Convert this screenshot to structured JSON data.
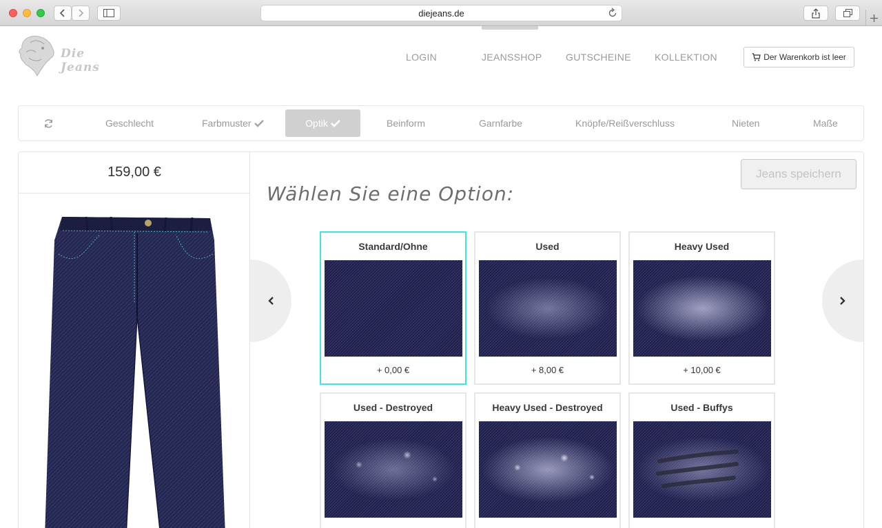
{
  "browser": {
    "url": "diejeans.de"
  },
  "brand": {
    "name": "Die Jeans"
  },
  "nav": {
    "items": [
      {
        "label": "LOGIN"
      },
      {
        "label": "JEANSSHOP"
      },
      {
        "label": "GUTSCHEINE"
      },
      {
        "label": "KOLLEKTION"
      }
    ],
    "cart_label": "Der Warenkorb ist leer"
  },
  "steps": [
    {
      "label": "Geschlecht"
    },
    {
      "label": "Farbmuster"
    },
    {
      "label": "Optik"
    },
    {
      "label": "Beinform"
    },
    {
      "label": "Garnfarbe"
    },
    {
      "label": "Knöpfe/Reißverschluss"
    },
    {
      "label": "Nieten"
    },
    {
      "label": "Maße"
    }
  ],
  "product": {
    "price": "159,00 €"
  },
  "main": {
    "headline": "Wählen Sie eine Option:",
    "save_label": "Jeans speichern",
    "options": [
      {
        "title": "Standard/Ohne",
        "price": "+ 0,00 €"
      },
      {
        "title": "Used",
        "price": "+ 8,00 €"
      },
      {
        "title": "Heavy Used",
        "price": "+ 10,00 €"
      },
      {
        "title": "Used - Destroyed",
        "price": ""
      },
      {
        "title": "Heavy Used - Destroyed",
        "price": ""
      },
      {
        "title": "Used - Buffys",
        "price": ""
      }
    ]
  },
  "colors": {
    "selected_border": "#3ee6e0",
    "denim": "#1f2048"
  }
}
